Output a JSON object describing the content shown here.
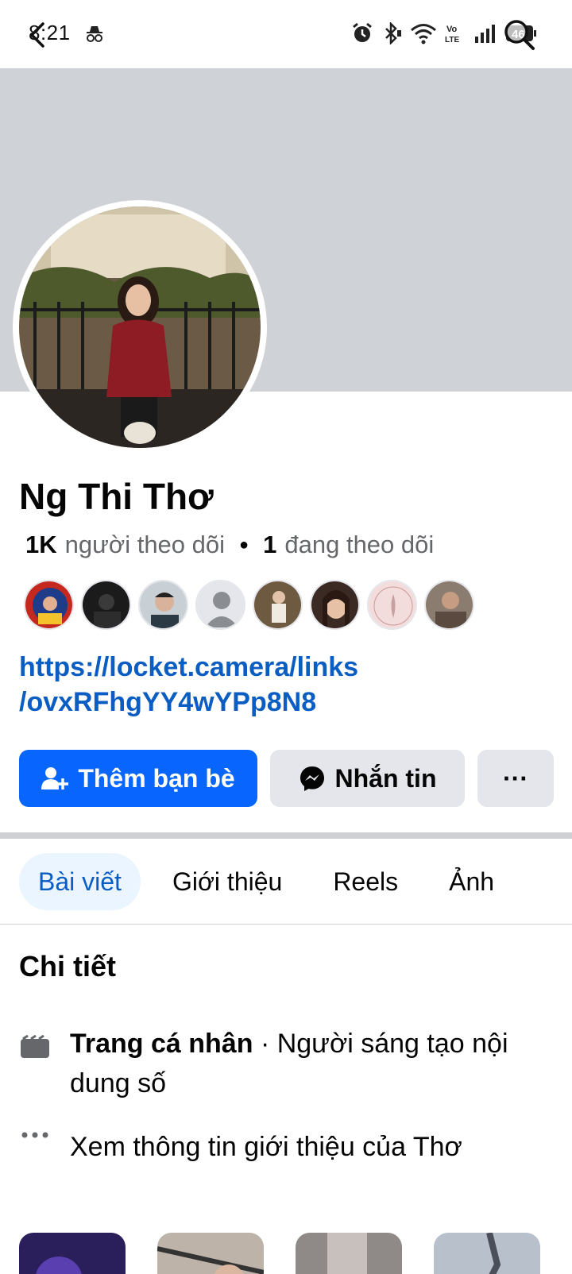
{
  "status_bar": {
    "time": "8:21",
    "battery": "46",
    "icons": [
      "incognito-icon",
      "alarm-icon",
      "bluetooth-icon",
      "wifi-icon",
      "volte-icon",
      "signal-icon",
      "battery-icon"
    ]
  },
  "profile": {
    "name": "Ng Thi Thơ",
    "followers_count": "1K",
    "followers_label": "người theo dõi",
    "following_count": "1",
    "following_label": "đang theo dõi",
    "link_line1": "https://locket.camera/links",
    "link_line2": "/ovxRFhgYY4wYPp8N8"
  },
  "actions": {
    "add_friend": "Thêm bạn bè",
    "message": "Nhắn tin",
    "more": "···"
  },
  "tabs": [
    "Bài viết",
    "Giới thiệu",
    "Reels",
    "Ảnh"
  ],
  "details": {
    "title": "Chi tiết",
    "page_type_bold": "Trang cá nhân",
    "page_type_rest": " · Người sáng tạo nội dung số",
    "see_about": "Xem thông tin giới thiệu của Thơ"
  },
  "colors": {
    "accent": "#0866ff",
    "link": "#0a5dc2",
    "cover": "#cfd2d7"
  }
}
